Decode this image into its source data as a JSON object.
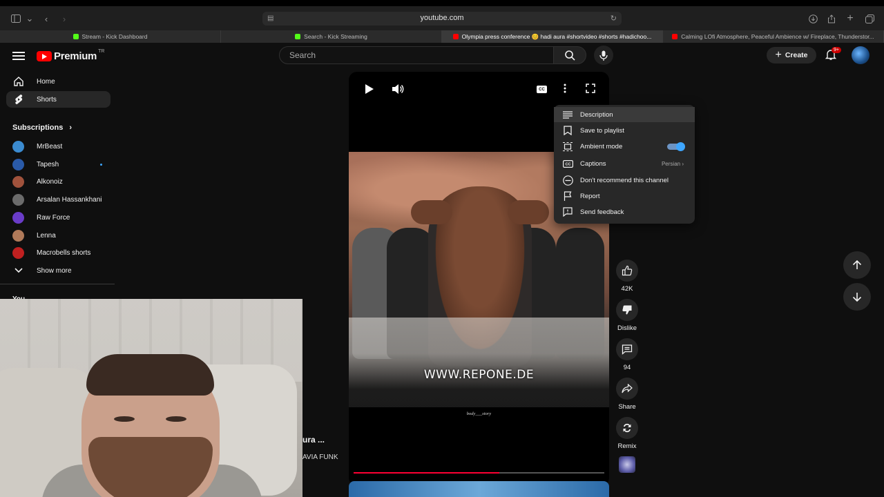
{
  "browser": {
    "url": "youtube.com",
    "tabs": [
      {
        "label": "Stream - Kick Dashboard",
        "fav_color": "#53fc18"
      },
      {
        "label": "Search - Kick Streaming",
        "fav_color": "#53fc18"
      },
      {
        "label": "Olympia press conference 😊 hadi aura #shortvideo #shorts #hadichoo...",
        "fav_color": "#ff0000"
      },
      {
        "label": "Calming LOfi Atmosphere, Peaceful Ambience w/ Fireplace, Thunderstor...",
        "fav_color": "#ff0000"
      }
    ]
  },
  "header": {
    "brand": "Premium",
    "region": "TR",
    "search_placeholder": "Search",
    "create_label": "Create",
    "notif_count": "9+"
  },
  "sidebar": {
    "home": "Home",
    "shorts": "Shorts",
    "subscriptions_title": "Subscriptions",
    "subscriptions": [
      {
        "name": "MrBeast",
        "color": "#3b8bd0"
      },
      {
        "name": "Tapesh",
        "color": "#2a5aa8",
        "new": true
      },
      {
        "name": "Alkonoiz",
        "color": "#a0523c"
      },
      {
        "name": "Arsalan Hassankhani",
        "color": "#6b6b6b"
      },
      {
        "name": "Raw Force",
        "color": "#6a3cc8"
      },
      {
        "name": "Lenna",
        "color": "#b07a5a"
      },
      {
        "name": "Macrobells shorts",
        "color": "#c02020"
      }
    ],
    "show_more": "Show more",
    "you_label": "You"
  },
  "player": {
    "watermark": "WWW.REPONE.DE",
    "credit": "body___story",
    "progress": 0.58
  },
  "behind_webcam": {
    "title_fragment": "ura ...",
    "subtitle_fragment": "AVIA FUNK"
  },
  "actions": {
    "likes": "42K",
    "dislike": "Dislike",
    "comments": "94",
    "share": "Share",
    "remix": "Remix"
  },
  "menu": {
    "description": "Description",
    "save_to_playlist": "Save to playlist",
    "ambient_mode": "Ambient mode",
    "captions": "Captions",
    "captions_value": "Persian",
    "dont_recommend": "Don't recommend this channel",
    "report": "Report",
    "send_feedback": "Send feedback"
  }
}
